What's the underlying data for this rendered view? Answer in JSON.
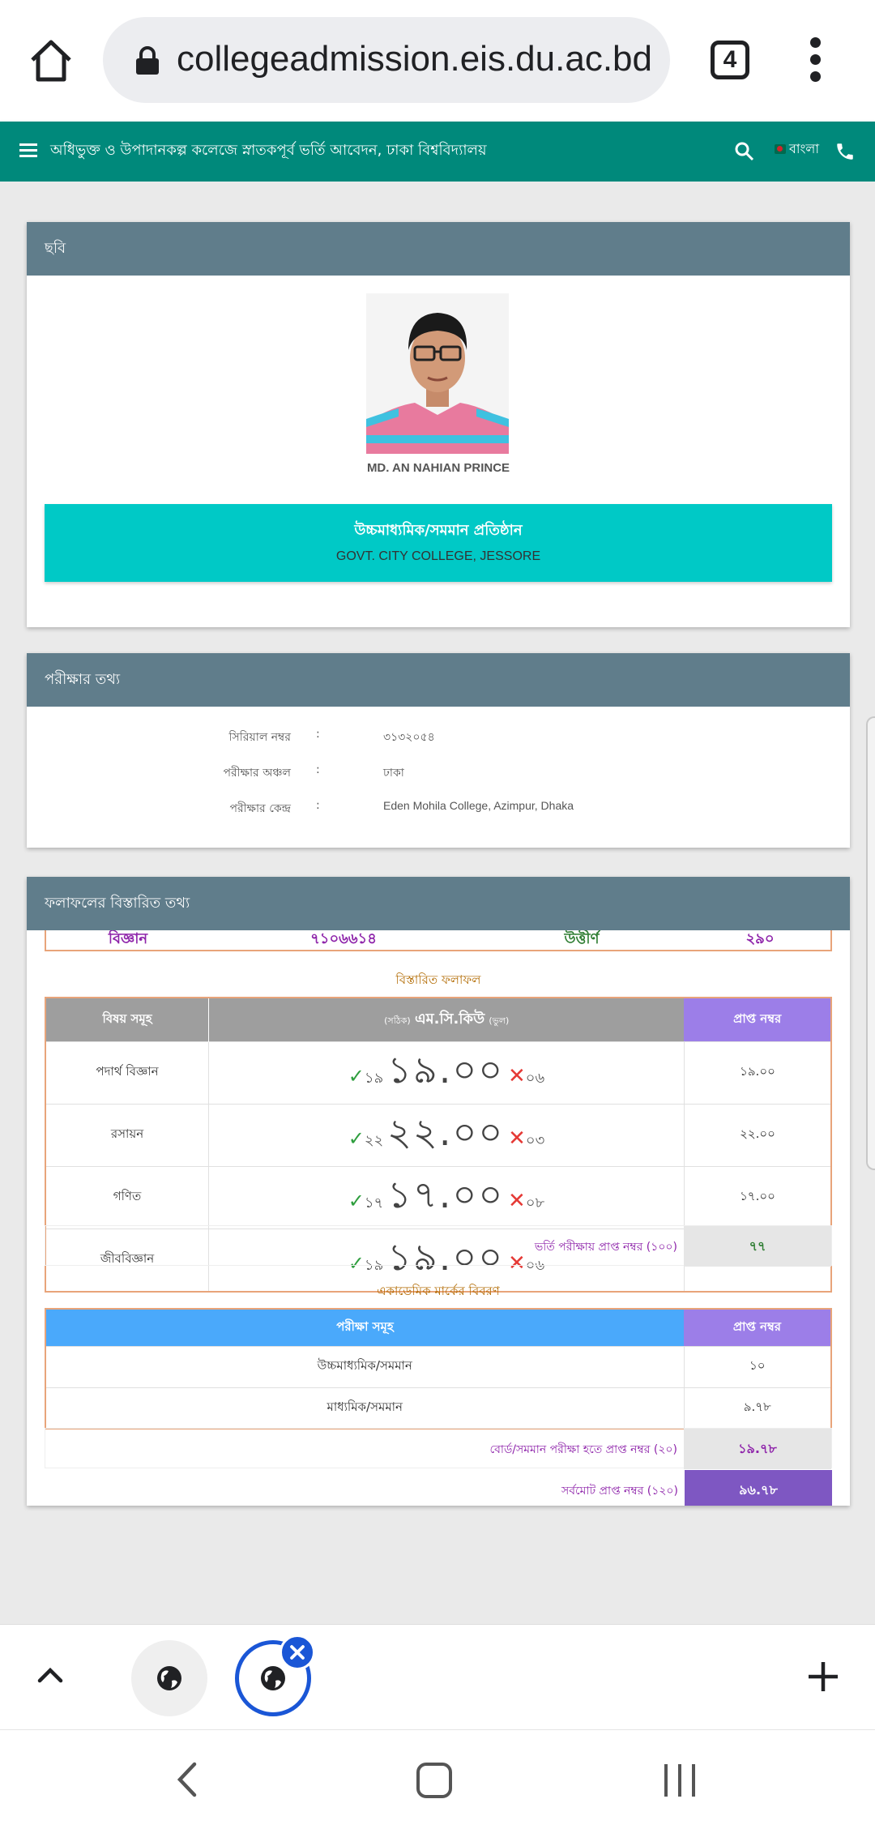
{
  "browser": {
    "url": "collegeadmission.eis.du.ac.bd",
    "tab_count": "4"
  },
  "header": {
    "title": "অধিভুক্ত ও উপাদানকল্প কলেজে স্নাতকপূর্ব ভর্তি আবেদন, ঢাকা বিশ্ববিদ্যালয়",
    "language": "বাংলা"
  },
  "photo_card": {
    "heading": "ছবি",
    "student_name": "MD. AN NAHIAN PRINCE",
    "institution_label": "উচ্চমাধ্যমিক/সমমান প্রতিষ্ঠান",
    "institution_name": "GOVT. CITY COLLEGE, JESSORE"
  },
  "exam_card": {
    "heading": "পরীক্ষার তথ্য",
    "rows": [
      {
        "label": "সিরিয়াল নম্বর",
        "colon": ":",
        "value": "৩১৩২০৫৪"
      },
      {
        "label": "পরীক্ষার অঞ্চল",
        "colon": ":",
        "value": "ঢাকা"
      },
      {
        "label": "পরীক্ষার কেন্দ্র",
        "colon": ":",
        "value": "Eden Mohila College, Azimpur, Dhaka"
      }
    ]
  },
  "result_card": {
    "heading": "ফলাফলের বিস্তারিত তথ্য",
    "summary": {
      "unit": "বিজ্ঞান",
      "roll": "৭১০৬৬১৪",
      "status": "উত্তীর্ণ",
      "position": "২৯০"
    },
    "detail_heading": "বিস্তারিত ফলাফল",
    "table_headers": {
      "subject": "বিষয় সমূহ",
      "mcq_correct": "(সঠিক)",
      "mcq": "এম.সি.কিউ",
      "mcq_wrong": "(ভুল)",
      "obtained": "প্রাপ্ত নম্বর"
    },
    "subjects": [
      {
        "name": "পদার্থ বিজ্ঞান",
        "correct": "১৯",
        "mcq": "১৯.০০",
        "wrong": "০৬",
        "obtained": "১৯.০০"
      },
      {
        "name": "রসায়ন",
        "correct": "২২",
        "mcq": "২২.০০",
        "wrong": "০৩",
        "obtained": "২২.০০"
      },
      {
        "name": "গণিত",
        "correct": "১৭",
        "mcq": "১৭.০০",
        "wrong": "০৮",
        "obtained": "১৭.০০"
      },
      {
        "name": "জীববিজ্ঞান",
        "correct": "১৯",
        "mcq": "১৯.০০",
        "wrong": "০৬",
        "obtained": "১৯.০০"
      }
    ],
    "admission_total_label": "ভর্তি পরীক্ষায় প্রাপ্ত নম্বর (১০০)",
    "admission_total_value": "৭৭",
    "academic_heading": "একাডেমিক মার্কের বিবরণ",
    "academic_headers": {
      "exam": "পরীক্ষা সমূহ",
      "obtained": "প্রাপ্ত নম্বর"
    },
    "academic_rows": [
      {
        "exam": "উচ্চমাধ্যমিক/সমমান",
        "obtained": "১০"
      },
      {
        "exam": "মাধ্যমিক/সমমান",
        "obtained": "৯.৭৮"
      }
    ],
    "board_total_label": "বোর্ড/সমমান পরীক্ষা হতে প্রাপ্ত নম্বর (২০)",
    "board_total_value": "১৯.৭৮",
    "grand_total_label": "সর্বমোট প্রাপ্ত নম্বর (১২০)",
    "grand_total_value": "৯৬.৭৮"
  },
  "colors": {
    "header_bg": "#00897b",
    "card_head_bg": "#607d8b",
    "institution_bg": "#00c9c6",
    "purple_accent": "#7e57c2",
    "status_green": "#2e7d32",
    "blue_accent": "#1a56d6"
  },
  "icons": [
    "home-icon",
    "lock-icon",
    "tabs-counter-icon",
    "more-vert-icon",
    "hamburger-icon",
    "search-icon",
    "bangladesh-flag-icon",
    "phone-icon",
    "tick-icon",
    "cross-icon",
    "chevron-up-icon",
    "globe-icon",
    "close-icon",
    "plus-icon",
    "back-icon",
    "home-nav-icon",
    "recents-icon"
  ]
}
